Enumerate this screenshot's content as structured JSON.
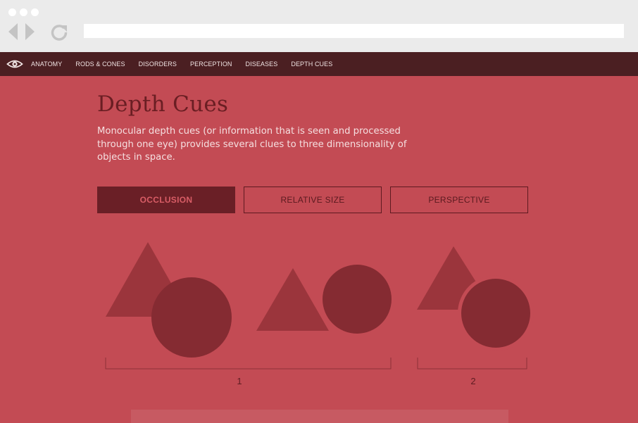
{
  "browser": {
    "url": "",
    "icons": [
      "window-dot-icon",
      "back-arrow-icon",
      "forward-arrow-icon",
      "reload-icon"
    ]
  },
  "nav": {
    "logo_icon": "eye-icon",
    "items": [
      {
        "label": "ANATOMY"
      },
      {
        "label": "RODS & CONES"
      },
      {
        "label": "DISORDERS"
      },
      {
        "label": "PERCEPTION"
      },
      {
        "label": "DISEASES"
      },
      {
        "label": "DEPTH CUES"
      }
    ]
  },
  "page": {
    "title": "Depth Cues",
    "intro": "Monocular depth cues (or information that is seen and processed through one eye) provides several clues to three dimensionality of objects in space."
  },
  "tabs": [
    {
      "label": "OCCLUSION",
      "active": true
    },
    {
      "label": "RELATIVE SIZE",
      "active": false
    },
    {
      "label": "PERSPECTIVE",
      "active": false
    }
  ],
  "illustration": {
    "groups": [
      {
        "label": "1"
      },
      {
        "label": "2"
      }
    ]
  },
  "colors": {
    "background": "#c34b54",
    "nav": "#4b1f22",
    "shape_dark": "#852b32",
    "shape_light": "#9b353c",
    "title": "#6a1e23",
    "active_tab": "#6a1f26"
  }
}
